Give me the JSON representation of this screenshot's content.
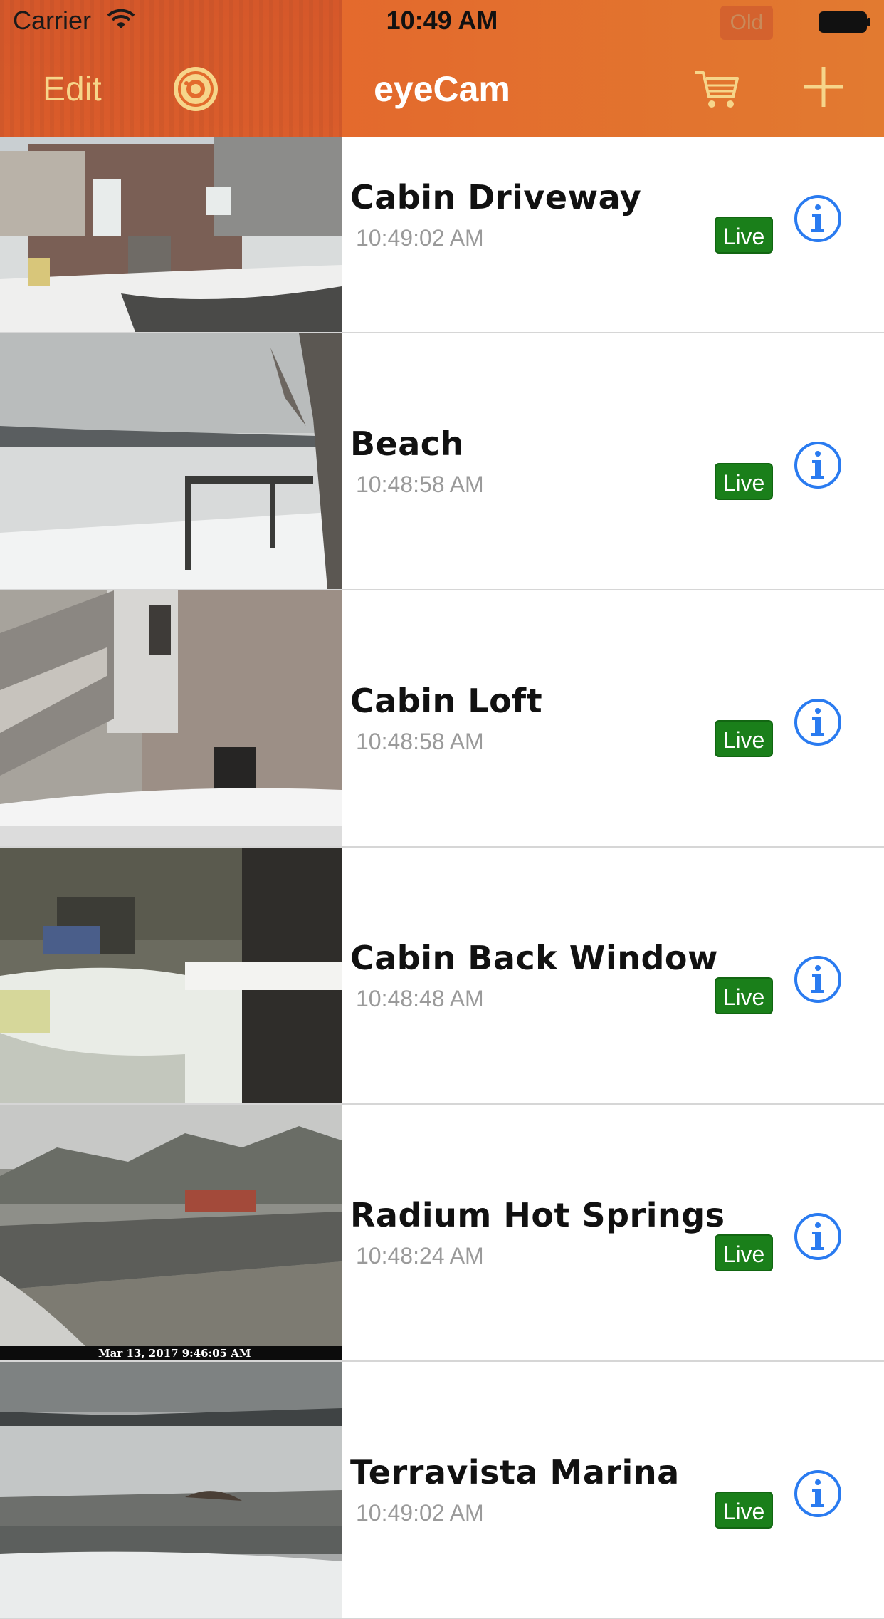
{
  "status_bar": {
    "carrier": "Carrier",
    "time": "10:49 AM",
    "old_badge": "Old"
  },
  "nav": {
    "edit_label": "Edit",
    "title": "eyeCam",
    "icons": [
      "camera-lens-icon",
      "cart-icon",
      "plus-icon"
    ]
  },
  "colors": {
    "header_gradient_start": "#e8622a",
    "header_gradient_end": "#e27a30",
    "accent_yellow": "#f6d58a",
    "live_green": "#1a7f1a",
    "info_blue": "#2a7bf0"
  },
  "cameras": [
    {
      "name": "Cabin Driveway",
      "time": "10:49:02 AM",
      "status": "Live"
    },
    {
      "name": "Beach",
      "time": "10:48:58 AM",
      "status": "Live"
    },
    {
      "name": "Cabin Loft",
      "time": "10:48:58 AM",
      "status": "Live"
    },
    {
      "name": "Cabin Back Window",
      "time": "10:48:48 AM",
      "status": "Live"
    },
    {
      "name": "Radium Hot Springs",
      "time": "10:48:24 AM",
      "status": "Live",
      "thumbnail_caption": "Mar 13, 2017 9:46:05 AM"
    },
    {
      "name": "Terravista Marina",
      "time": "10:49:02 AM",
      "status": "Live"
    }
  ]
}
